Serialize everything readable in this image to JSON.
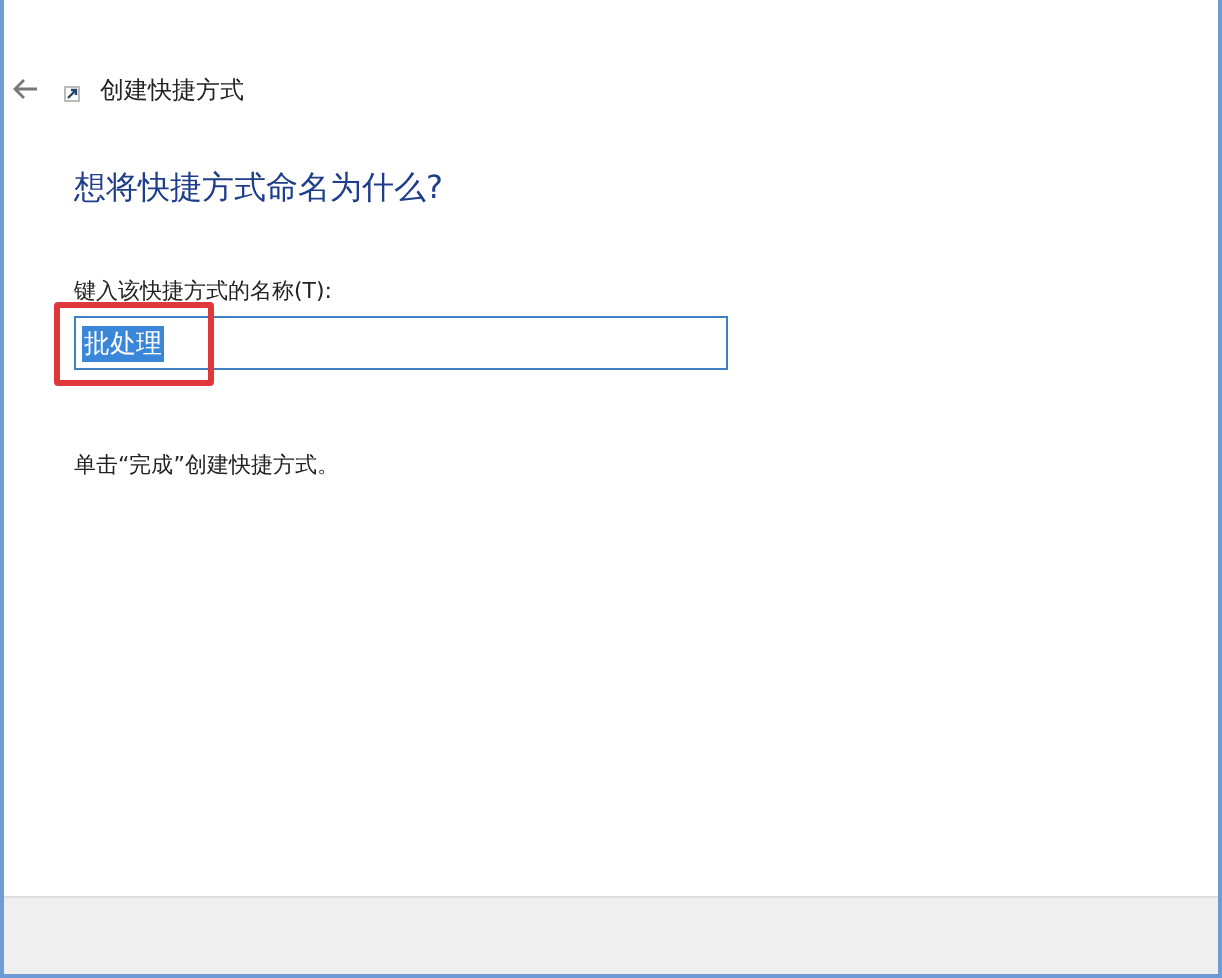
{
  "window": {
    "title": "创建快捷方式"
  },
  "heading": "想将快捷方式命名为什么?",
  "name_field": {
    "label": "键入该快捷方式的名称(T):",
    "value": "批处理",
    "text_selected": true
  },
  "hint": "单击“完成”创建快捷方式。"
}
